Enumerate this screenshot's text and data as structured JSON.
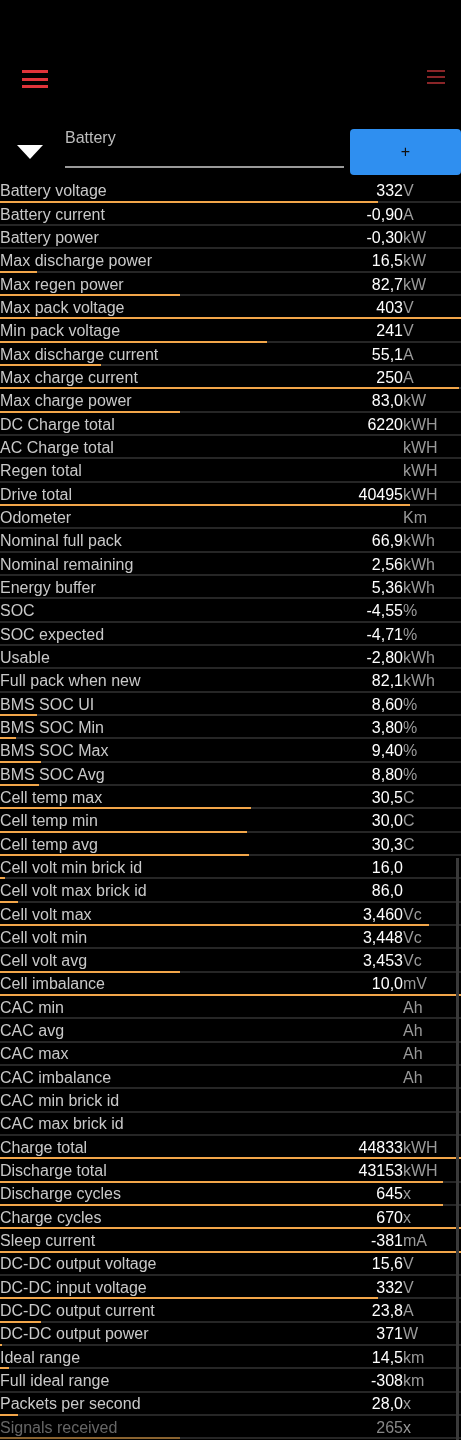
{
  "toolbar": {
    "left_menu": {
      "highlighted": true
    },
    "right_menu": {
      "highlighted": false
    }
  },
  "selector": {
    "value": "Battery",
    "add_button": "+"
  },
  "rows": [
    {
      "label": "Battery voltage",
      "value": "332",
      "unit": "V",
      "level": 0.82
    },
    {
      "label": "Battery current",
      "value": "-0,90",
      "unit": "A"
    },
    {
      "label": "Battery power",
      "value": "-0,30",
      "unit": "kW"
    },
    {
      "label": "Max discharge power",
      "value": "16,5",
      "unit": "kW",
      "level": 0.08
    },
    {
      "label": "Max regen power",
      "value": "82,7",
      "unit": "kW",
      "level": 0.39
    },
    {
      "label": "Max pack voltage",
      "value": "403",
      "unit": "V",
      "level": 1
    },
    {
      "label": "Min pack voltage",
      "value": "241",
      "unit": "V",
      "level": 0.58
    },
    {
      "label": "Max discharge current",
      "value": "55,1",
      "unit": "A",
      "level": 0.22
    },
    {
      "label": "Max charge current",
      "value": "250",
      "unit": "A",
      "level": 0.995
    },
    {
      "label": "Max charge power",
      "value": "83,0",
      "unit": "kW",
      "level": 0.39
    },
    {
      "label": "DC Charge total",
      "value": "6220",
      "unit": "kWH"
    },
    {
      "label": "AC Charge total",
      "unit": "kWH"
    },
    {
      "label": "Regen total",
      "unit": "kWH"
    },
    {
      "label": "Drive total",
      "value": "40495",
      "unit": "kWH",
      "level": 0.89
    },
    {
      "label": "Odometer",
      "unit": "Km"
    },
    {
      "label": "Nominal full pack",
      "value": "66,9",
      "unit": "kWh"
    },
    {
      "label": "Nominal remaining",
      "value": "2,56",
      "unit": "kWh"
    },
    {
      "label": "Energy buffer",
      "value": "5,36",
      "unit": "kWh"
    },
    {
      "label": "SOC",
      "value": "-4,55",
      "unit": "%"
    },
    {
      "label": "SOC expected",
      "value": "-4,71",
      "unit": "%"
    },
    {
      "label": "Usable",
      "value": "-2,80",
      "unit": "kWh"
    },
    {
      "label": "Full pack when new",
      "value": "82,1",
      "unit": "kWh"
    },
    {
      "label": "BMS SOC UI",
      "value": "8,60",
      "unit": "%",
      "level": 0.08
    },
    {
      "label": "BMS SOC Min",
      "value": "3,80",
      "unit": "%",
      "level": 0.035
    },
    {
      "label": "BMS SOC Max",
      "value": "9,40",
      "unit": "%",
      "level": 0.09
    },
    {
      "label": "BMS SOC Avg",
      "value": "8,80",
      "unit": "%",
      "level": 0.085
    },
    {
      "label": "Cell temp max",
      "value": "30,5",
      "unit": "C",
      "level": 0.545
    },
    {
      "label": "Cell temp min",
      "value": "30,0",
      "unit": "C",
      "level": 0.535
    },
    {
      "label": "Cell temp avg",
      "value": "30,3",
      "unit": "C",
      "level": 0.54
    },
    {
      "label": "Cell volt min brick id",
      "value": "16,0",
      "level": 0.01
    },
    {
      "label": "Cell volt max brick id",
      "value": "86,0",
      "level": 0.04
    },
    {
      "label": "Cell volt max",
      "value": "3,460",
      "unit": "Vc",
      "level": 0.93
    },
    {
      "label": "Cell volt min",
      "value": "3,448",
      "unit": "Vc"
    },
    {
      "label": "Cell volt avg",
      "value": "3,453",
      "unit": "Vc",
      "level": 0.39
    },
    {
      "label": "Cell imbalance",
      "value": "10,0",
      "unit": "mV",
      "level": 1
    },
    {
      "label": "CAC min",
      "unit": "Ah"
    },
    {
      "label": "CAC avg",
      "unit": "Ah"
    },
    {
      "label": "CAC max",
      "unit": "Ah"
    },
    {
      "label": "CAC imbalance",
      "unit": "Ah"
    },
    {
      "label": "CAC min brick id"
    },
    {
      "label": "CAC max brick id"
    },
    {
      "label": "Charge total",
      "value": "44833",
      "unit": "kWH",
      "level": 1
    },
    {
      "label": "Discharge total",
      "value": "43153",
      "unit": "kWH",
      "level": 0.96
    },
    {
      "label": "Discharge cycles",
      "value": "645",
      "unit": "x",
      "level": 0.96
    },
    {
      "label": "Charge cycles",
      "value": "670",
      "unit": "x",
      "level": 1
    },
    {
      "label": "Sleep current",
      "value": "-381",
      "unit": "mA",
      "level": 1
    },
    {
      "label": "DC-DC output voltage",
      "value": "15,6",
      "unit": "V"
    },
    {
      "label": "DC-DC input voltage",
      "value": "332",
      "unit": "V",
      "level": 0.82
    },
    {
      "label": "DC-DC output current",
      "value": "23,8",
      "unit": "A",
      "level": 0.09
    },
    {
      "label": "DC-DC output power",
      "value": "371",
      "unit": "W",
      "level": 0.005
    },
    {
      "label": "Ideal range",
      "value": "14,5",
      "unit": "km",
      "level": 0.02
    },
    {
      "label": "Full ideal range",
      "value": "-308",
      "unit": "km"
    },
    {
      "label": "Packets per second",
      "value": "28,0",
      "unit": "x",
      "level": 0.04
    },
    {
      "label": "Signals received",
      "value": "265",
      "unit": "x",
      "level": 0.39
    }
  ]
}
